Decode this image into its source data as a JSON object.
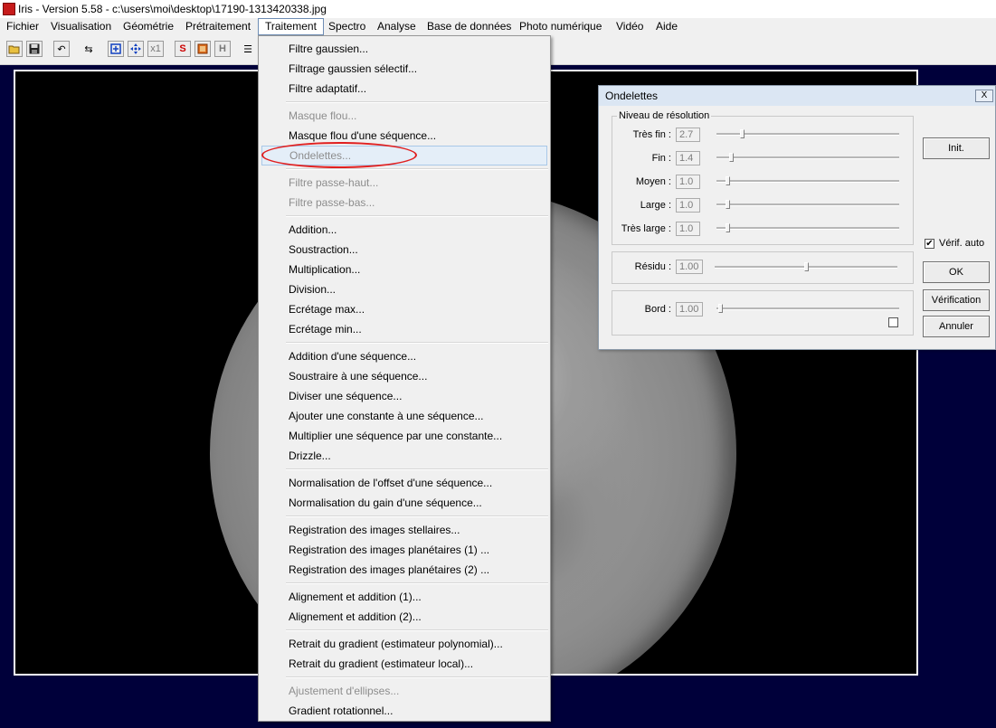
{
  "window": {
    "title": "Iris - Version 5.58 - c:\\users\\moi\\desktop\\17190-1313420338.jpg"
  },
  "menubar": [
    "Fichier",
    "Visualisation",
    "Géométrie",
    "Prétraitement",
    "Traitement",
    "Spectro",
    "Analyse",
    "Base de données",
    "Photo numérique",
    "Vidéo",
    "Aide"
  ],
  "toolbar": [
    {
      "name": "open-icon",
      "glyph": ""
    },
    {
      "name": "save-icon",
      "glyph": ""
    },
    {
      "name": "undo-icon",
      "glyph": "↶"
    },
    {
      "name": "sliders-icon",
      "glyph": "⇆"
    },
    {
      "name": "zoom-fit-icon",
      "glyph": ""
    },
    {
      "name": "move-icon",
      "glyph": ""
    },
    {
      "name": "zoom-x1-icon",
      "glyph": "x1"
    },
    {
      "name": "s-icon",
      "glyph": "S"
    },
    {
      "name": "palette-icon",
      "glyph": ""
    },
    {
      "name": "h-icon",
      "glyph": "H"
    },
    {
      "name": "list-icon",
      "glyph": "☰"
    }
  ],
  "menu": {
    "items": [
      {
        "label": "Filtre gaussien...",
        "enabled": true
      },
      {
        "label": "Filtrage gaussien sélectif...",
        "enabled": true
      },
      {
        "label": "Filtre adaptatif...",
        "enabled": true
      },
      {
        "sep": true
      },
      {
        "label": "Masque flou...",
        "enabled": false
      },
      {
        "label": "Masque flou d'une séquence...",
        "enabled": true
      },
      {
        "label": "Ondelettes...",
        "enabled": false,
        "highlight": true
      },
      {
        "sep": true
      },
      {
        "label": "Filtre passe-haut...",
        "enabled": false
      },
      {
        "label": "Filtre passe-bas...",
        "enabled": false
      },
      {
        "sep": true
      },
      {
        "label": "Addition...",
        "enabled": true
      },
      {
        "label": "Soustraction...",
        "enabled": true
      },
      {
        "label": "Multiplication...",
        "enabled": true
      },
      {
        "label": "Division...",
        "enabled": true
      },
      {
        "label": "Ecrétage max...",
        "enabled": true
      },
      {
        "label": "Ecrétage min...",
        "enabled": true
      },
      {
        "sep": true
      },
      {
        "label": "Addition d'une séquence...",
        "enabled": true
      },
      {
        "label": "Soustraire à une séquence...",
        "enabled": true
      },
      {
        "label": "Diviser une séquence...",
        "enabled": true
      },
      {
        "label": "Ajouter une constante à une séquence...",
        "enabled": true
      },
      {
        "label": "Multiplier une séquence par une constante...",
        "enabled": true
      },
      {
        "label": "Drizzle...",
        "enabled": true
      },
      {
        "sep": true
      },
      {
        "label": "Normalisation de l'offset d'une séquence...",
        "enabled": true
      },
      {
        "label": "Normalisation du gain d'une séquence...",
        "enabled": true
      },
      {
        "sep": true
      },
      {
        "label": "Registration des images stellaires...",
        "enabled": true
      },
      {
        "label": "Registration des images planétaires (1) ...",
        "enabled": true
      },
      {
        "label": "Registration des images planétaires (2) ...",
        "enabled": true
      },
      {
        "sep": true
      },
      {
        "label": "Alignement et addition (1)...",
        "enabled": true
      },
      {
        "label": "Alignement et addition (2)...",
        "enabled": true
      },
      {
        "sep": true
      },
      {
        "label": "Retrait du gradient (estimateur polynomial)...",
        "enabled": true
      },
      {
        "label": "Retrait du gradient (estimateur local)...",
        "enabled": true
      },
      {
        "sep": true
      },
      {
        "label": "Ajustement d'ellipses...",
        "enabled": false
      },
      {
        "label": "Gradient rotationnel...",
        "enabled": true
      }
    ]
  },
  "dialog": {
    "title": "Ondelettes",
    "close_label": "X",
    "group_label": "Niveau de résolution",
    "levels": [
      {
        "label": "Très fin :",
        "value": "2.7",
        "slider": 0.13
      },
      {
        "label": "Fin :",
        "value": "1.4",
        "slider": 0.07
      },
      {
        "label": "Moyen :",
        "value": "1.0",
        "slider": 0.05
      },
      {
        "label": "Large :",
        "value": "1.0",
        "slider": 0.05
      },
      {
        "label": "Très large :",
        "value": "1.0",
        "slider": 0.05
      }
    ],
    "residu": {
      "label": "Résidu :",
      "value": "1.00",
      "slider": 0.5
    },
    "bord": {
      "label": "Bord :",
      "value": "1.00",
      "slider": 0.01
    },
    "verif_auto_label": "Vérif. auto",
    "verif_auto_checked": true,
    "buttons": {
      "init": "Init.",
      "ok": "OK",
      "verification": "Vérification",
      "annuler": "Annuler"
    }
  }
}
